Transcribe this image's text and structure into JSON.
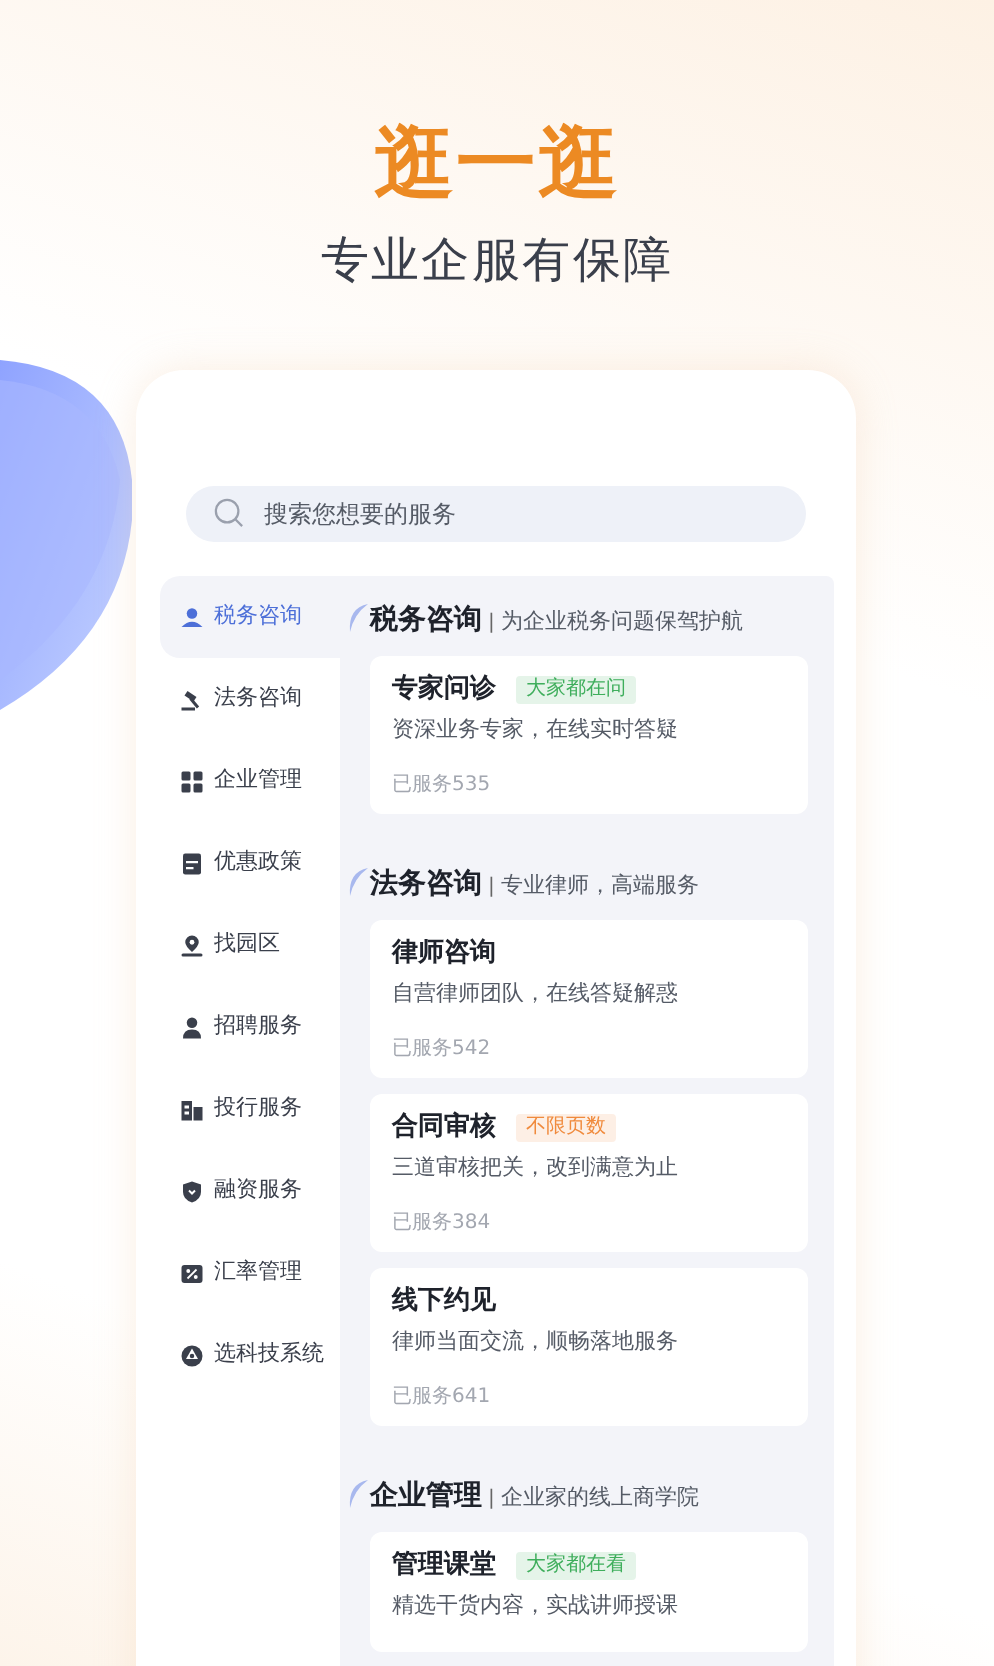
{
  "title": "逛一逛",
  "subtitle": "专业企服有保障",
  "search": {
    "placeholder": "搜索您想要的服务"
  },
  "sidebar": {
    "items": [
      {
        "label": "税务咨询",
        "selected": true
      },
      {
        "label": "法务咨询",
        "selected": false
      },
      {
        "label": "企业管理",
        "selected": false
      },
      {
        "label": "优惠政策",
        "selected": false
      },
      {
        "label": "找园区",
        "selected": false
      },
      {
        "label": "招聘服务",
        "selected": false
      },
      {
        "label": "投行服务",
        "selected": false
      },
      {
        "label": "融资服务",
        "selected": false
      },
      {
        "label": "汇率管理",
        "selected": false
      },
      {
        "label": "选科技系统",
        "selected": false
      }
    ]
  },
  "sections": [
    {
      "title": "税务咨询",
      "separator": "|",
      "tagline": "为企业税务问题保驾护航",
      "cards": [
        {
          "title": "专家问诊",
          "tag": {
            "text": "大家都在问",
            "color": "#3fae5c"
          },
          "description": "资深业务专家，在线实时答疑",
          "served": "已服务535"
        }
      ]
    },
    {
      "title": "法务咨询",
      "separator": "|",
      "tagline": "专业律师，高端服务",
      "cards": [
        {
          "title": "律师咨询",
          "description": "自营律师团队，在线答疑解惑",
          "served": "已服务542"
        },
        {
          "title": "合同审核",
          "tag": {
            "text": "不限页数",
            "color": "#f08a3c"
          },
          "description": "三道审核把关，改到满意为止",
          "served": "已服务384"
        },
        {
          "title": "线下约见",
          "description": "律师当面交流，顺畅落地服务",
          "served": "已服务641"
        }
      ]
    },
    {
      "title": "企业管理",
      "separator": "|",
      "tagline": "企业家的线上商学院",
      "cards": [
        {
          "title": "管理课堂",
          "tag": {
            "text": "大家都在看",
            "color": "#3fae5c"
          },
          "description": "精选干货内容，实战讲师授课"
        }
      ]
    }
  ]
}
